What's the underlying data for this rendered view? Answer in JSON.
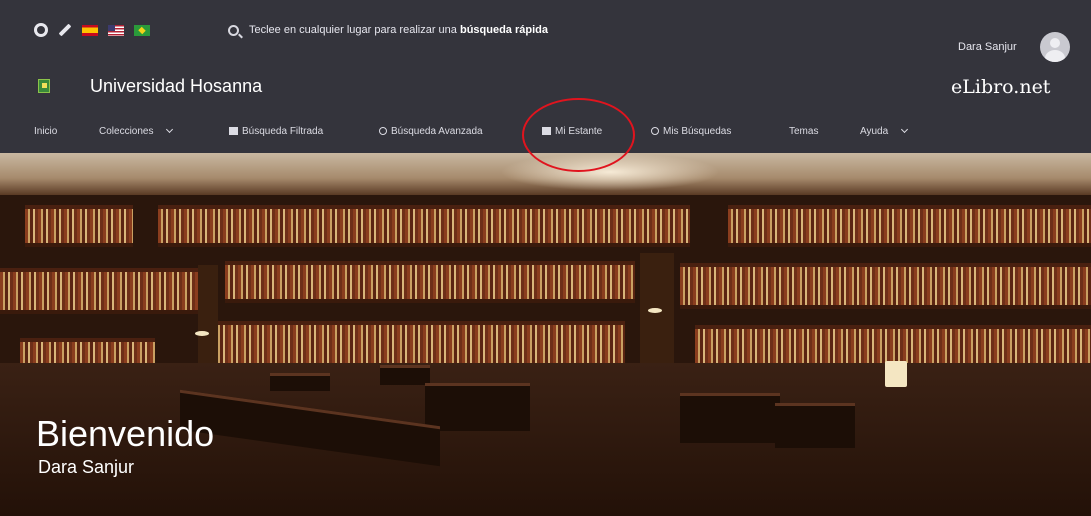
{
  "header": {
    "search_hint_prefix": "Teclee en cualquier lugar para realizar una",
    "search_hint_bold": "búsqueda rápida",
    "user_name": "Dara Sanjur",
    "institution": "Universidad Hosanna",
    "brand": "eLibro.net"
  },
  "nav": {
    "inicio": "Inicio",
    "colecciones": "Colecciones",
    "busqueda_filtrada": "Búsqueda Filtrada",
    "busqueda_avanzada": "Búsqueda Avanzada",
    "mi_estante": "Mi Estante",
    "mis_busquedas": "Mis Búsquedas",
    "temas": "Temas",
    "ayuda": "Ayuda"
  },
  "banner": {
    "greeting": "Bienvenido",
    "name": "Dara Sanjur"
  },
  "colors": {
    "header_bg": "#34343c",
    "highlight": "#e0141e"
  },
  "icons": [
    "globe-icon",
    "edit-icon",
    "flag-es-icon",
    "flag-us-icon",
    "flag-br-icon",
    "search-icon",
    "avatar",
    "logo-icon"
  ]
}
